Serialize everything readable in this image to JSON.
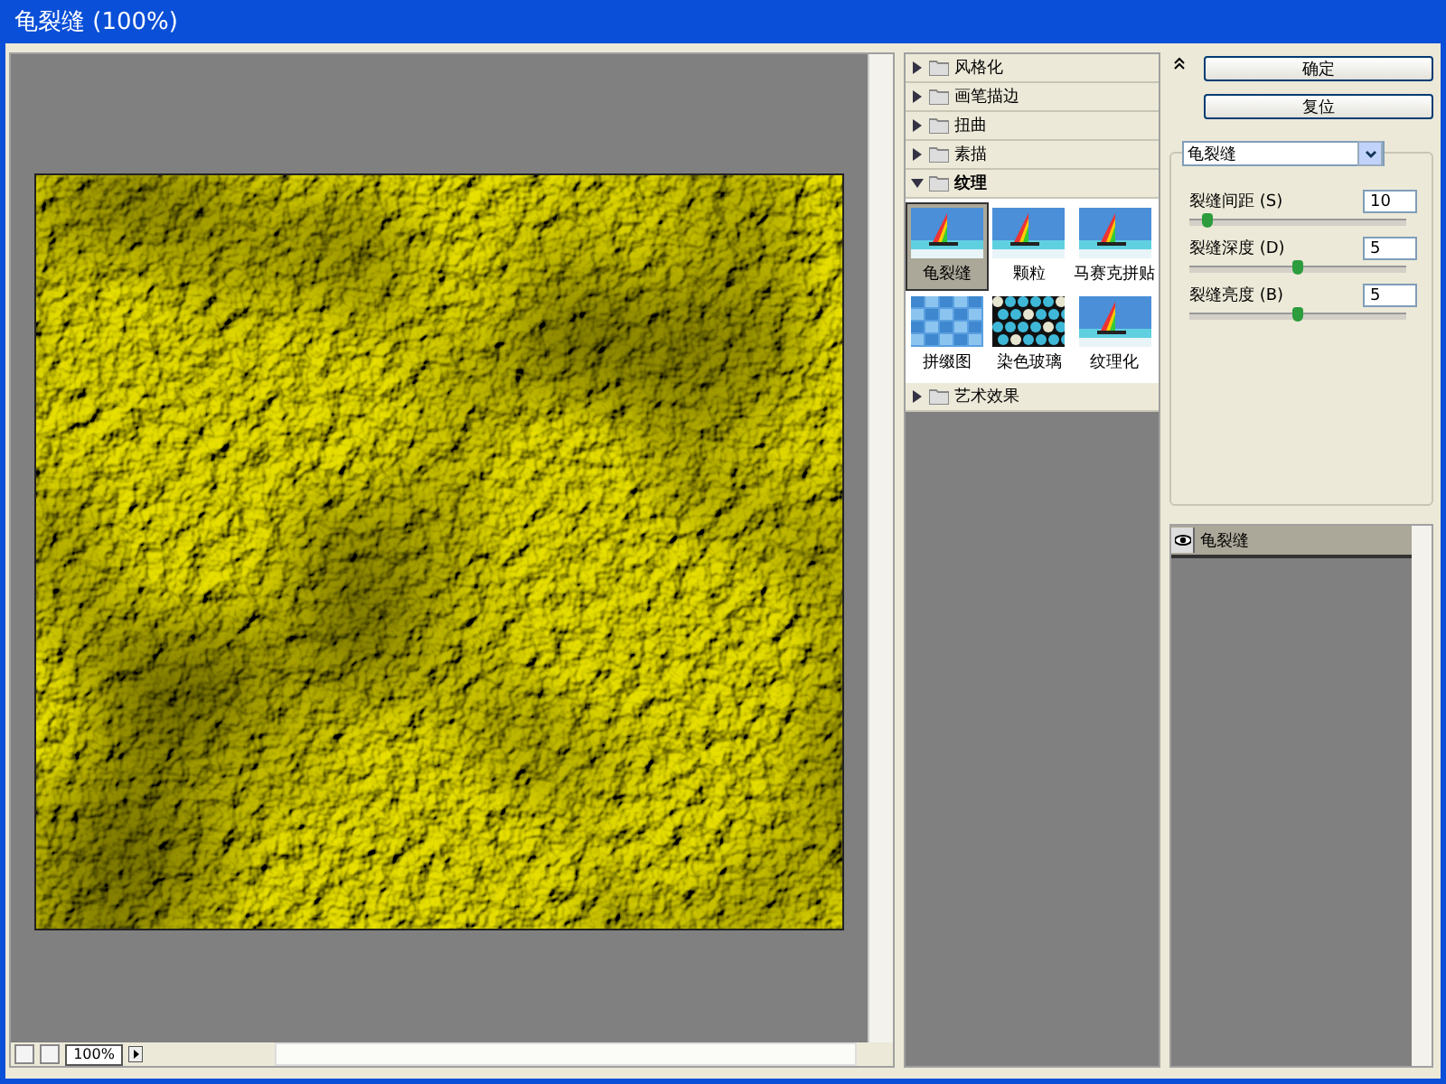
{
  "window": {
    "title": "龟裂缝 (100%)"
  },
  "preview": {
    "zoom": "100%"
  },
  "categories": [
    {
      "label": "风格化",
      "expanded": false
    },
    {
      "label": "画笔描边",
      "expanded": false
    },
    {
      "label": "扭曲",
      "expanded": false
    },
    {
      "label": "素描",
      "expanded": false
    },
    {
      "label": "纹理",
      "expanded": true,
      "filters": [
        {
          "label": "龟裂缝",
          "selected": true,
          "kind": "boat"
        },
        {
          "label": "颗粒",
          "selected": false,
          "kind": "boat"
        },
        {
          "label": "马赛克拼贴",
          "selected": false,
          "kind": "boat"
        },
        {
          "label": "拼缀图",
          "selected": false,
          "kind": "tiles"
        },
        {
          "label": "染色玻璃",
          "selected": false,
          "kind": "glass"
        },
        {
          "label": "纹理化",
          "selected": false,
          "kind": "boat"
        }
      ]
    },
    {
      "label": "艺术效果",
      "expanded": false
    }
  ],
  "buttons": [
    "确定",
    "复位"
  ],
  "filter_select": {
    "value": "龟裂缝"
  },
  "params": [
    {
      "label": "裂缝间距 (S)",
      "value": "10",
      "level": 0.08
    },
    {
      "label": "裂缝深度 (D)",
      "value": "5",
      "level": 0.5
    },
    {
      "label": "裂缝亮度 (B)",
      "value": "5",
      "level": 0.5
    }
  ],
  "layers": [
    {
      "label": "龟裂缝",
      "visible": true
    }
  ]
}
